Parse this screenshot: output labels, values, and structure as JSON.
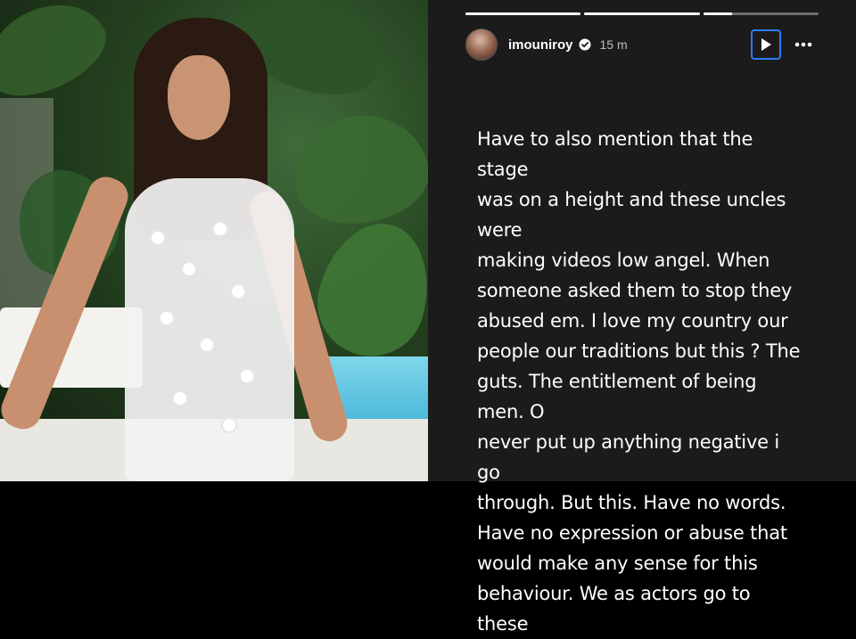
{
  "photo": {
    "alt": ""
  },
  "story": {
    "progress": [
      1,
      1,
      0.25
    ],
    "username": "imouniroy",
    "time": "15 m",
    "icons": {
      "verified": "verified-badge-icon",
      "play": "play-icon",
      "more": "more-horizontal-icon"
    },
    "accent": "#2e7cf6",
    "text_lines": [
      "Have to also mention that the stage",
      "was on a height and these uncles were",
      "making videos low angel. When",
      "someone asked them to stop they",
      "abused em. I love my country our",
      "people our traditions but this ? The",
      "guts. The entitlement of being men. O",
      "never put up anything negative i go",
      "through. But this. Have no words.",
      "Have no expression or abuse that",
      "would make any sense for this",
      "behaviour. We as actors go to these"
    ]
  }
}
